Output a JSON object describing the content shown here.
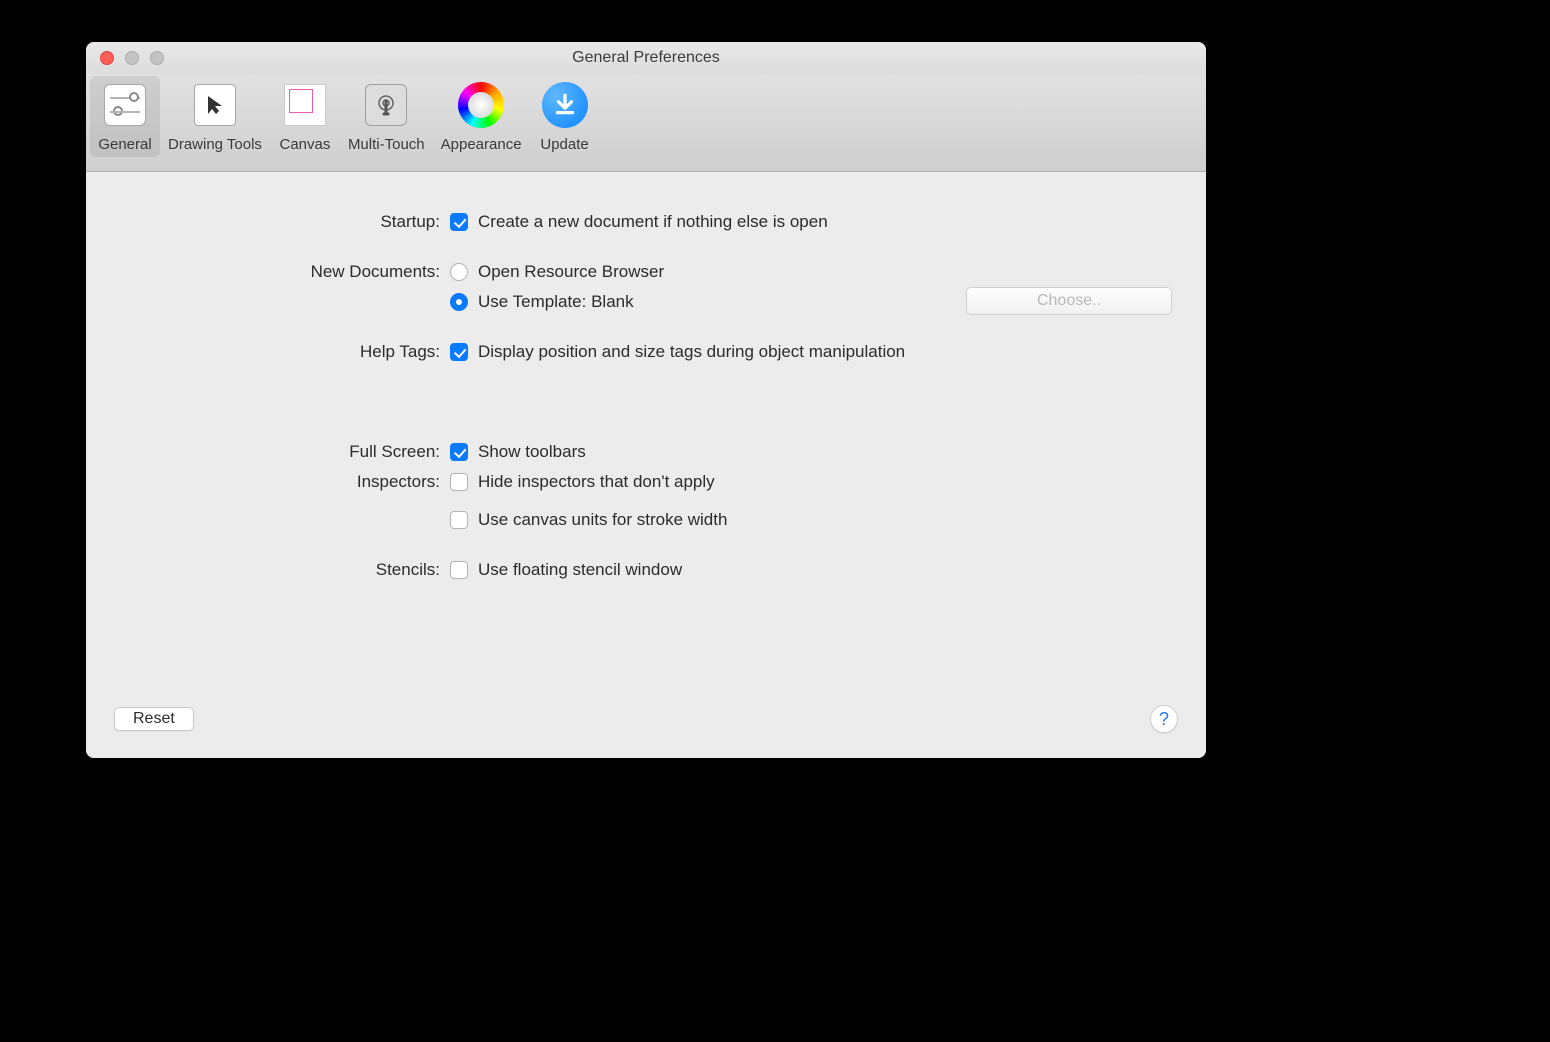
{
  "window": {
    "title": "General Preferences"
  },
  "toolbar": {
    "items": [
      {
        "label": "General"
      },
      {
        "label": "Drawing Tools"
      },
      {
        "label": "Canvas"
      },
      {
        "label": "Multi-Touch"
      },
      {
        "label": "Appearance"
      },
      {
        "label": "Update"
      }
    ]
  },
  "sections": {
    "startup": {
      "label": "Startup:"
    },
    "new_documents": {
      "label": "New Documents:"
    },
    "help_tags": {
      "label": "Help Tags:"
    },
    "full_screen": {
      "label": "Full Screen:"
    },
    "inspectors": {
      "label": "Inspectors:"
    },
    "stencils": {
      "label": "Stencils:"
    }
  },
  "options": {
    "startup_create_new": "Create a new document if nothing else is open",
    "open_resource": "Open Resource Browser",
    "use_template": "Use Template: Blank",
    "help_tags_display": "Display position and size tags during object manipulation",
    "show_toolbars": "Show toolbars",
    "hide_inspectors": "Hide inspectors that don't apply",
    "canvas_units_stroke": "Use canvas units for stroke width",
    "floating_stencil": "Use floating stencil window"
  },
  "buttons": {
    "choose": "Choose..",
    "reset": "Reset",
    "help": "?"
  }
}
